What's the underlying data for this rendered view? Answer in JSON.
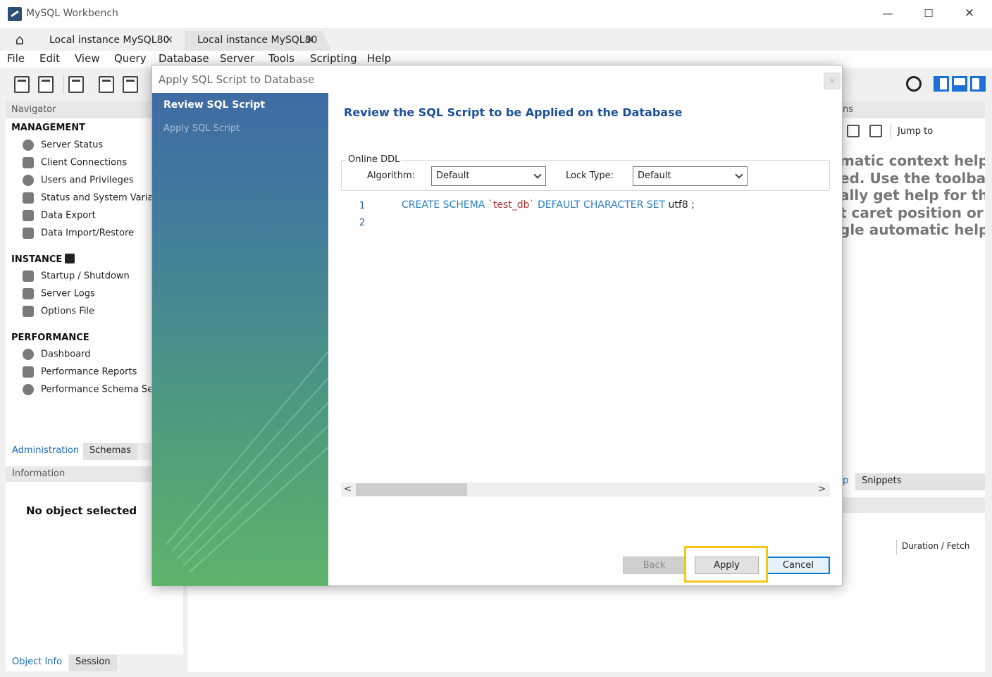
{
  "window": {
    "title": "MySQL Workbench",
    "minimize": "—",
    "maximize": "☐",
    "close": "✕"
  },
  "tabs": [
    {
      "label": "Local instance MySQL80",
      "close": "✕"
    },
    {
      "label": "Local instance MySQL80",
      "close": "✕"
    }
  ],
  "home_icon": "⌂",
  "menu": [
    "File",
    "Edit",
    "View",
    "Query",
    "Database",
    "Server",
    "Tools",
    "Scripting",
    "Help"
  ],
  "navigator": {
    "header": "Navigator",
    "management": {
      "title": "MANAGEMENT",
      "items": [
        "Server Status",
        "Client Connections",
        "Users and Privileges",
        "Status and System Variables",
        "Data Export",
        "Data Import/Restore"
      ]
    },
    "instance": {
      "title": "INSTANCE",
      "items": [
        "Startup / Shutdown",
        "Server Logs",
        "Options File"
      ]
    },
    "performance": {
      "title": "PERFORMANCE",
      "items": [
        "Dashboard",
        "Performance Reports",
        "Performance Schema Setup"
      ]
    },
    "tabs": [
      "Administration",
      "Schemas"
    ]
  },
  "information": {
    "header": "Information",
    "empty_text": "No object selected",
    "tabs": [
      "Object Info",
      "Session"
    ]
  },
  "right_panel": {
    "header_fragment": "ns",
    "jump_to": "Jump to",
    "help_lines": [
      "matic context help is",
      "ed. Use the toolbar to",
      "ally get help for the",
      "t caret position or to",
      "gle automatic help."
    ],
    "tab_help_fragment": "p",
    "tab_snippets": "Snippets",
    "duration_column": "Duration / Fetch"
  },
  "dialog": {
    "title": "Apply SQL Script to Database",
    "close": "✕",
    "steps": [
      "Review SQL Script",
      "Apply SQL Script"
    ],
    "heading": "Review the SQL Script to be Applied on the Database",
    "online_ddl": {
      "legend": "Online DDL",
      "algorithm_label": "Algorithm:",
      "algorithm_value": "Default",
      "lock_label": "Lock Type:",
      "lock_value": "Default"
    },
    "editor": {
      "line_numbers": [
        "1",
        "2"
      ],
      "line1": {
        "kw1": "CREATE SCHEMA",
        "str": "`test_db`",
        "kw2": "DEFAULT CHARACTER SET",
        "rest": "utf8 ;"
      }
    },
    "scroll_left": "<",
    "scroll_right": ">",
    "buttons": {
      "back": "Back",
      "apply": "Apply",
      "cancel": "Cancel"
    }
  },
  "colors": {
    "highlight": "#f5c518",
    "heading": "#1c4f9a",
    "keyword": "#2a7fc6",
    "string": "#b03535"
  }
}
